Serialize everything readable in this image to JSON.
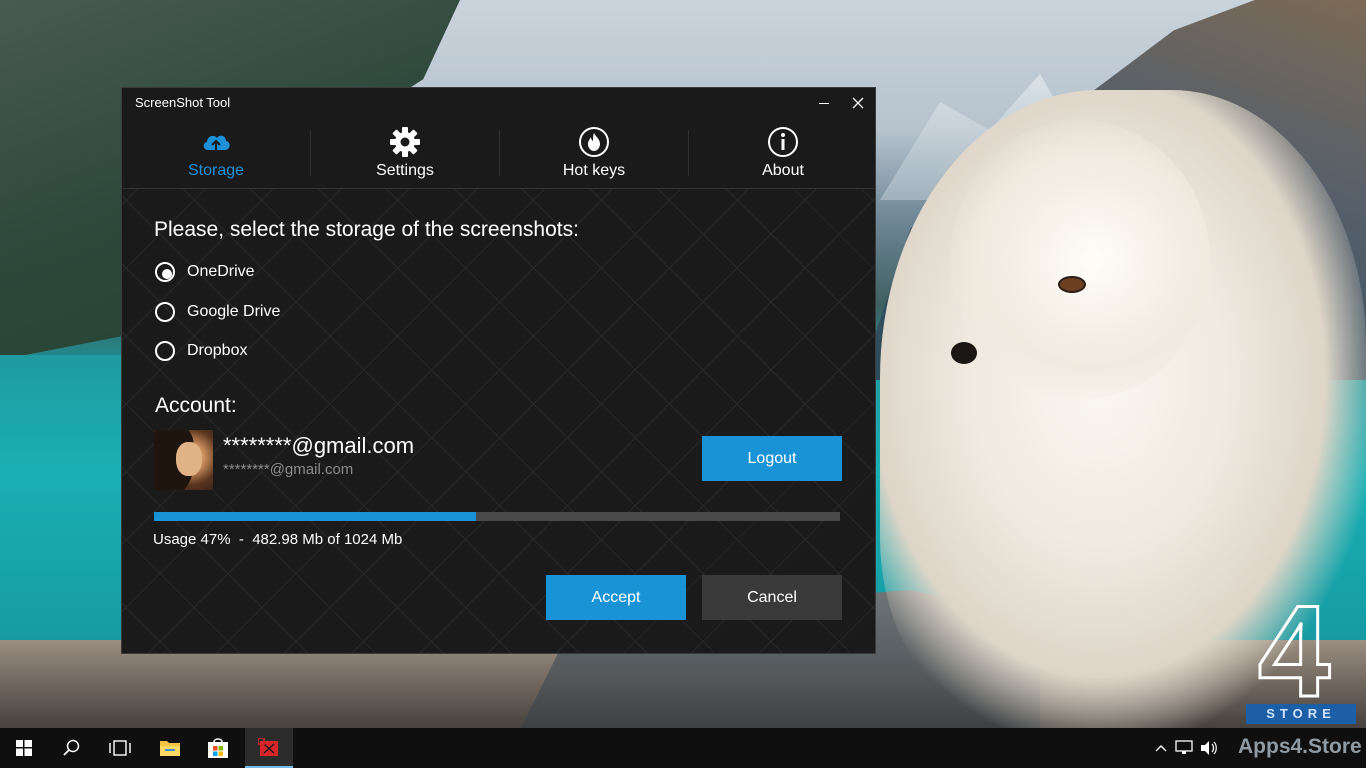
{
  "window": {
    "title": "ScreenShot Tool",
    "accent_color": "#1a93d6"
  },
  "nav": {
    "items": [
      {
        "label": "Storage",
        "icon": "cloud-upload-icon",
        "active": true
      },
      {
        "label": "Settings",
        "icon": "gear-icon",
        "active": false
      },
      {
        "label": "Hot keys",
        "icon": "flame-icon",
        "active": false
      },
      {
        "label": "About",
        "icon": "info-icon",
        "active": false
      }
    ]
  },
  "storage": {
    "heading": "Please, select the storage of the screenshots:",
    "options": [
      {
        "label": "OneDrive",
        "selected": true
      },
      {
        "label": "Google Drive",
        "selected": false
      },
      {
        "label": "Dropbox",
        "selected": false
      }
    ]
  },
  "account": {
    "heading": "Account:",
    "email_primary": "********@gmail.com",
    "email_secondary": "********@gmail.com",
    "logout_label": "Logout",
    "usage_fraction": 0.47,
    "usage_text": "Usage 47%  -  482.98 Mb of 1024 Mb"
  },
  "actions": {
    "accept_label": "Accept",
    "cancel_label": "Cancel"
  },
  "desktop": {
    "watermark_text": "STORE",
    "brand_text": "Apps4.Store"
  }
}
